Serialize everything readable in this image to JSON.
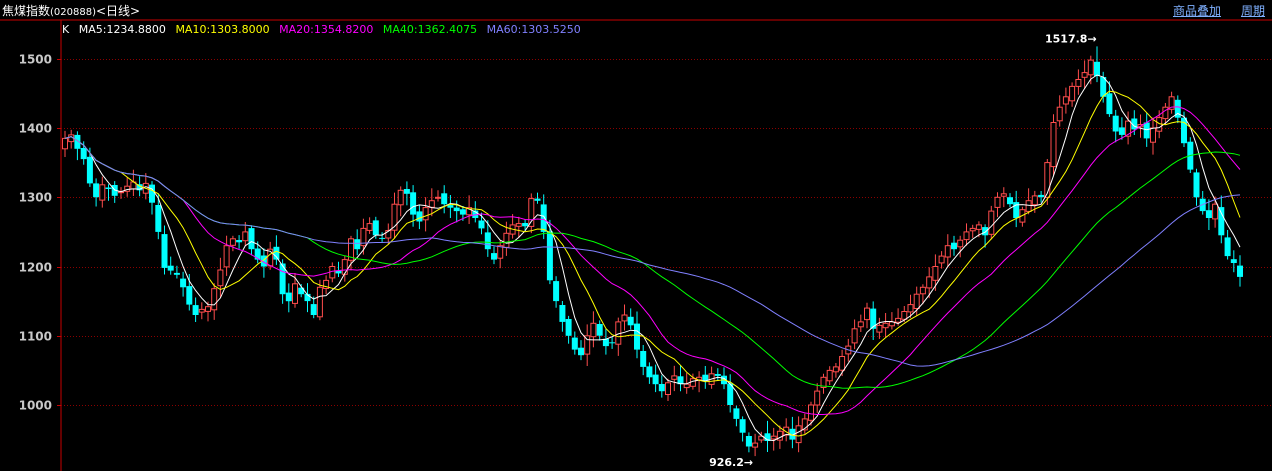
{
  "header": {
    "title": "焦煤指数",
    "code": "(020888)",
    "period": "<日线>",
    "links": [
      "商品叠加",
      "周期"
    ]
  },
  "legend": {
    "k_label": "K",
    "items": [
      {
        "text": "MA5:1234.8800",
        "color": "#ffffff"
      },
      {
        "text": "MA10:1303.8000",
        "color": "#ffff00"
      },
      {
        "text": "MA20:1354.8200",
        "color": "#ff00ff"
      },
      {
        "text": "MA40:1362.4075",
        "color": "#00ff00"
      },
      {
        "text": "MA60:1303.5250",
        "color": "#8080ff"
      }
    ]
  },
  "colors": {
    "up": "#ff4d4d",
    "down": "#00ffff",
    "grid": "#8b0000",
    "axis": "#c80000"
  },
  "chart_data": {
    "type": "candlestick",
    "y_ticks": [
      1000,
      1100,
      1200,
      1300,
      1400,
      1500
    ],
    "ylim": [
      925,
      1545
    ],
    "annotations": [
      {
        "text": "1517.8",
        "value": 1517.8,
        "kind": "high"
      },
      {
        "text": "926.2",
        "value": 926.2,
        "kind": "low"
      }
    ],
    "ma_last_values": {
      "MA5": 1234.88,
      "MA10": 1303.8,
      "MA20": 1354.82,
      "MA40": 1362.4075,
      "MA60": 1303.525
    },
    "close": [
      1385,
      1390,
      1370,
      1355,
      1320,
      1300,
      1318,
      1312,
      1302,
      1308,
      1316,
      1322,
      1310,
      1320,
      1292,
      1250,
      1198,
      1194,
      1188,
      1170,
      1145,
      1130,
      1138,
      1142,
      1168,
      1195,
      1230,
      1240,
      1235,
      1250,
      1225,
      1210,
      1200,
      1225,
      1210,
      1160,
      1150,
      1175,
      1160,
      1150,
      1130,
      1170,
      1180,
      1200,
      1190,
      1210,
      1240,
      1225,
      1255,
      1262,
      1245,
      1240,
      1252,
      1290,
      1310,
      1305,
      1275,
      1265,
      1285,
      1295,
      1300,
      1290,
      1285,
      1280,
      1275,
      1285,
      1270,
      1255,
      1225,
      1210,
      1230,
      1248,
      1260,
      1262,
      1258,
      1298,
      1295,
      1250,
      1180,
      1150,
      1120,
      1100,
      1080,
      1072,
      1100,
      1118,
      1100,
      1085,
      1090,
      1120,
      1130,
      1115,
      1080,
      1055,
      1040,
      1030,
      1020,
      1032,
      1042,
      1030,
      1030,
      1038,
      1040,
      1035,
      1045,
      1042,
      1030,
      1000,
      980,
      960,
      940,
      945,
      955,
      948,
      955,
      962,
      968,
      950,
      970,
      980,
      1000,
      1020,
      1040,
      1050,
      1055,
      1070,
      1085,
      1110,
      1120,
      1140,
      1110,
      1115,
      1118,
      1120,
      1125,
      1135,
      1145,
      1160,
      1170,
      1185,
      1200,
      1215,
      1230,
      1225,
      1238,
      1250,
      1255,
      1260,
      1245,
      1280,
      1300,
      1305,
      1290,
      1270,
      1282,
      1295,
      1302,
      1300,
      1350,
      1408,
      1430,
      1445,
      1460,
      1470,
      1480,
      1498,
      1475,
      1445,
      1420,
      1395,
      1390,
      1410,
      1398,
      1405,
      1385,
      1400,
      1415,
      1430,
      1445,
      1415,
      1378,
      1340,
      1300,
      1280,
      1270,
      1290,
      1245,
      1215,
      1205,
      1185
    ]
  }
}
